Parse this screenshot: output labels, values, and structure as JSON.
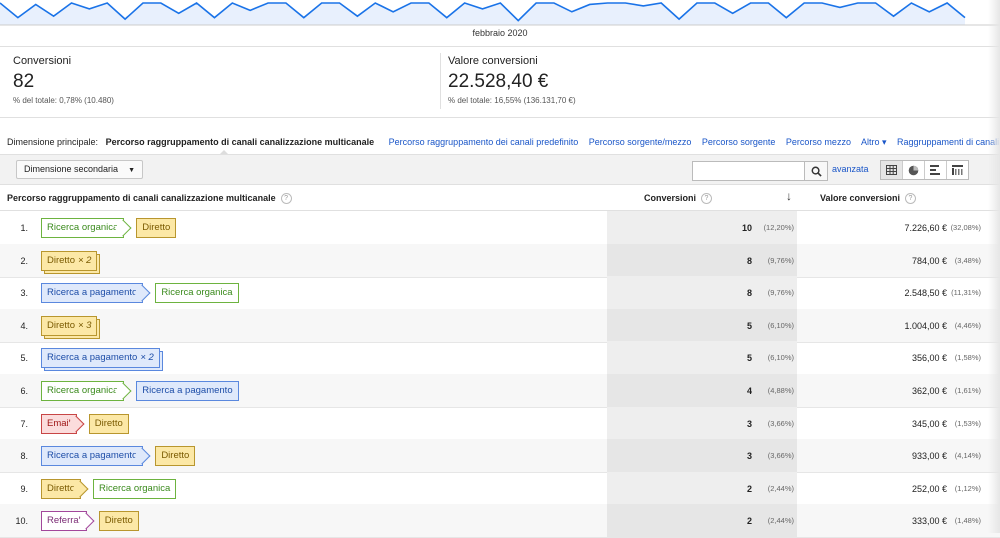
{
  "chart_data": {
    "type": "line",
    "xlabel": "febbraio 2020",
    "values": [
      30,
      10,
      28,
      12,
      30,
      22,
      30,
      8,
      30,
      30,
      16,
      30,
      10,
      30,
      20,
      30,
      30,
      10,
      30,
      30,
      12,
      30,
      18,
      30,
      30,
      10,
      30,
      22,
      30,
      6,
      30,
      30,
      18,
      28,
      30,
      30,
      26,
      30,
      8,
      30,
      30,
      16,
      30,
      30,
      10,
      30,
      30,
      24,
      30,
      30,
      12,
      30,
      18,
      30,
      10
    ],
    "color": "#1a73e8"
  },
  "summary": {
    "conversions": {
      "label": "Conversioni",
      "value": "82",
      "pct": "% del totale: 0,78% (10.480)"
    },
    "value": {
      "label": "Valore conversioni",
      "value": "22.528,40 €",
      "pct": "% del totale: 16,55% (136.131,70 €)"
    }
  },
  "dimensions": {
    "label": "Dimensione principale:",
    "active": "Percorso raggruppamento di canali canalizzazione multicanale",
    "links": [
      "Percorso raggruppamento dei canali predefinito",
      "Percorso sorgente/mezzo",
      "Percorso sorgente",
      "Percorso mezzo",
      "Altro ▾",
      "Raggruppamenti di canali ▾"
    ]
  },
  "toolbar": {
    "secondary_dimension": "Dimensione secondaria",
    "search_placeholder": "",
    "advanced": "avanzata"
  },
  "table": {
    "col_path": "Percorso raggruppamento di canali canalizzazione multicanale",
    "col_conv": "Conversioni",
    "col_value": "Valore conversioni",
    "rows": [
      {
        "n": "1.",
        "path": [
          [
            "Ricerca organica",
            "green",
            ""
          ],
          [
            "Diretto",
            "yellow",
            ""
          ]
        ],
        "conv": "10",
        "conv_pct": "(12,20%)",
        "value": "7.226,60 €",
        "value_pct": "(32,08%)"
      },
      {
        "n": "2.",
        "path": [
          [
            "Diretto",
            "yellow",
            "× 2"
          ]
        ],
        "conv": "8",
        "conv_pct": "(9,76%)",
        "value": "784,00 €",
        "value_pct": "(3,48%)"
      },
      {
        "n": "3.",
        "path": [
          [
            "Ricerca a pagamento",
            "blue",
            ""
          ],
          [
            "Ricerca organica",
            "green",
            ""
          ]
        ],
        "conv": "8",
        "conv_pct": "(9,76%)",
        "value": "2.548,50 €",
        "value_pct": "(11,31%)"
      },
      {
        "n": "4.",
        "path": [
          [
            "Diretto",
            "yellow",
            "× 3"
          ]
        ],
        "conv": "5",
        "conv_pct": "(6,10%)",
        "value": "1.004,00 €",
        "value_pct": "(4,46%)"
      },
      {
        "n": "5.",
        "path": [
          [
            "Ricerca a pagamento",
            "blue",
            "× 2"
          ]
        ],
        "conv": "5",
        "conv_pct": "(6,10%)",
        "value": "356,00 €",
        "value_pct": "(1,58%)"
      },
      {
        "n": "6.",
        "path": [
          [
            "Ricerca organica",
            "green",
            ""
          ],
          [
            "Ricerca a pagamento",
            "blue",
            ""
          ]
        ],
        "conv": "4",
        "conv_pct": "(4,88%)",
        "value": "362,00 €",
        "value_pct": "(1,61%)"
      },
      {
        "n": "7.",
        "path": [
          [
            "Email",
            "red",
            ""
          ],
          [
            "Diretto",
            "yellow",
            ""
          ]
        ],
        "conv": "3",
        "conv_pct": "(3,66%)",
        "value": "345,00 €",
        "value_pct": "(1,53%)"
      },
      {
        "n": "8.",
        "path": [
          [
            "Ricerca a pagamento",
            "blue",
            ""
          ],
          [
            "Diretto",
            "yellow",
            ""
          ]
        ],
        "conv": "3",
        "conv_pct": "(3,66%)",
        "value": "933,00 €",
        "value_pct": "(4,14%)"
      },
      {
        "n": "9.",
        "path": [
          [
            "Diretto",
            "yellow",
            ""
          ],
          [
            "Ricerca organica",
            "green",
            ""
          ]
        ],
        "conv": "2",
        "conv_pct": "(2,44%)",
        "value": "252,00 €",
        "value_pct": "(1,12%)"
      },
      {
        "n": "10.",
        "path": [
          [
            "Referral",
            "pink",
            ""
          ],
          [
            "Diretto",
            "yellow",
            ""
          ]
        ],
        "conv": "2",
        "conv_pct": "(2,44%)",
        "value": "333,00 €",
        "value_pct": "(1,48%)"
      }
    ]
  }
}
